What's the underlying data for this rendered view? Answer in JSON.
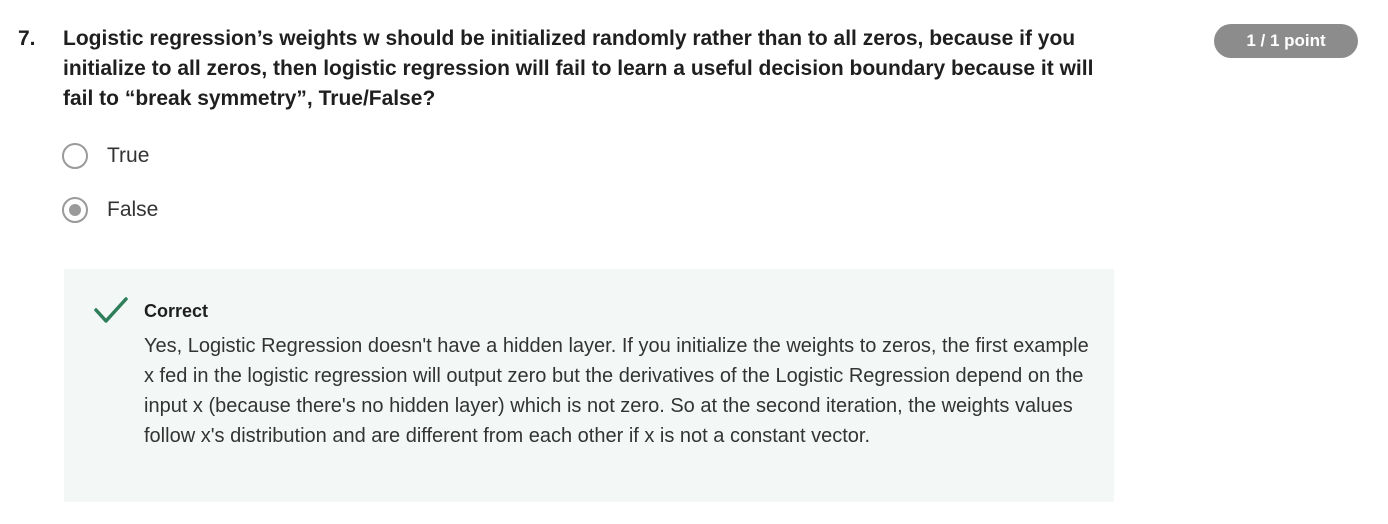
{
  "question": {
    "number": "7.",
    "text": "Logistic regression’s weights w should be initialized randomly rather than to all zeros, because if you initialize to all zeros, then logistic regression will fail to learn a useful decision boundary because it will fail to “break symmetry”, True/False?",
    "points": "1 / 1 point"
  },
  "options": [
    {
      "label": "True",
      "selected": false
    },
    {
      "label": "False",
      "selected": true
    }
  ],
  "feedback": {
    "status": "Correct",
    "icon": "check-icon",
    "color": "#2e7d5b",
    "background": "#f3f8f6",
    "text": "Yes, Logistic Regression doesn't have a hidden layer. If you initialize the weights to zeros, the first example x fed in the logistic regression will output zero but the derivatives of the Logistic Regression depend on the input x (because there's no hidden layer) which is not zero. So at the second iteration, the weights values follow x's distribution and are different from each other if x is not a constant vector."
  },
  "colors": {
    "badge": "#8c8c8c",
    "radio": "#9a9a9a"
  }
}
